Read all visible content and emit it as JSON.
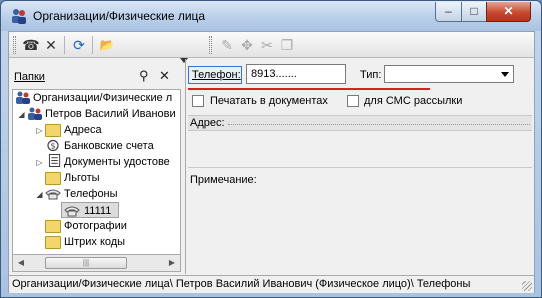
{
  "window": {
    "title": "Организации/Физические лица",
    "min_symbol": "–",
    "max_symbol": "□",
    "close_symbol": "✕"
  },
  "toolbar": {
    "buttons": [
      {
        "icon": "phone-icon",
        "glyph": "☎",
        "enabled": true
      },
      {
        "icon": "delete-icon",
        "glyph": "✕",
        "enabled": true
      },
      {
        "icon": "refresh-icon",
        "glyph": "⟳",
        "enabled": true
      },
      {
        "icon": "open-folder-icon",
        "glyph": "📂",
        "enabled": true
      },
      {
        "icon": "edit-icon",
        "glyph": "✎",
        "enabled": false
      },
      {
        "icon": "move-icon",
        "glyph": "✥",
        "enabled": false
      },
      {
        "icon": "cut-icon",
        "glyph": "✂",
        "enabled": false
      },
      {
        "icon": "copy-icon",
        "glyph": "❐",
        "enabled": false
      }
    ]
  },
  "left_pane": {
    "title": "Папки",
    "search_glyph": "⚲",
    "close_glyph": "✕",
    "tree": [
      {
        "label": "Организации/Физические л",
        "expander": "",
        "icon": "people-icon"
      },
      {
        "label": "Петров Василий Иванови",
        "expander": "◢",
        "icon": "person-icon"
      },
      {
        "label": "Адреса",
        "expander": "▷",
        "icon": "folder-icon"
      },
      {
        "label": "Банковские счета",
        "expander": "",
        "icon": "money-icon"
      },
      {
        "label": "Документы удостове",
        "expander": "▷",
        "icon": "document-icon"
      },
      {
        "label": "Льготы",
        "expander": "",
        "icon": "folder-icon"
      },
      {
        "label": "Телефоны",
        "expander": "◢",
        "icon": "phone-icon"
      },
      {
        "label": "11111",
        "expander": "",
        "icon": "phone-icon",
        "selected": true
      },
      {
        "label": "Фотографии",
        "expander": "",
        "icon": "folder-icon"
      },
      {
        "label": "Штрих коды",
        "expander": "",
        "icon": "folder-icon"
      }
    ],
    "scroll_left": "◀",
    "scroll_right": "▶",
    "thumb_grip": "|||"
  },
  "form": {
    "phone_label": "Телефон:",
    "phone_value": "8913.......",
    "type_label": "Тип:",
    "type_value": "",
    "print_label": "Печатать в документах",
    "print_checked": false,
    "sms_label": "для СМС рассылки",
    "sms_checked": false,
    "address_label": "Адрес:",
    "note_label": "Примечание:"
  },
  "status": {
    "path": "Организации/Физические лица\\ Петров Василий Иванович (Физическое лицо)\\ Телефоны"
  }
}
